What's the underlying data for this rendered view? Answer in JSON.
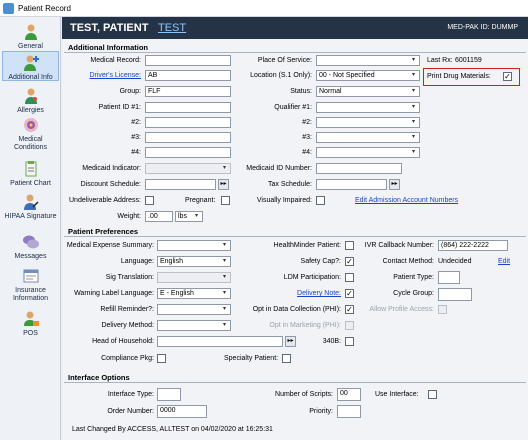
{
  "window": {
    "title": "Patient Record"
  },
  "sidebar": {
    "items": [
      {
        "label": "General",
        "icon": "person-icon"
      },
      {
        "label": "Additional Info",
        "icon": "person-plus-icon"
      },
      {
        "label": "Allergies",
        "icon": "allergy-icon"
      },
      {
        "label": "Medical Conditions",
        "icon": "condition-icon"
      },
      {
        "label": "Patient Chart",
        "icon": "chart-icon"
      },
      {
        "label": "HIPAA Signature",
        "icon": "signature-icon"
      },
      {
        "label": "Messages",
        "icon": "messages-icon"
      },
      {
        "label": "Insurance Information",
        "icon": "insurance-icon"
      },
      {
        "label": "POS",
        "icon": "pos-icon"
      }
    ]
  },
  "header": {
    "patient_name": "TEST, PATIENT",
    "patient_link": "TEST",
    "medpak": "MED-PAK ID: DUMMP"
  },
  "additional": {
    "heading": "Additional Information",
    "medical_record_label": "Medical Record:",
    "medical_record_value": "",
    "drivers_license_label": "Driver's License:",
    "drivers_license_value": "AB",
    "group_label": "Group:",
    "group_value": "FLF",
    "patient_id1_label": "Patient ID #1:",
    "id2_label": "#2:",
    "id3_label": "#3:",
    "id4_label": "#4:",
    "medicaid_indicator_label": "Medicaid Indicator:",
    "discount_schedule_label": "Discount Schedule:",
    "undeliverable_label": "Undeliverable Address:",
    "pregnant_label": "Pregnant:",
    "weight_label": "Weight:",
    "weight_value": ".00",
    "weight_unit": "lbs",
    "place_of_service_label": "Place Of Service:",
    "location_label": "Location (S.1 Only):",
    "location_value": "00 - Not Specified",
    "status_label": "Status:",
    "status_value": "Normal",
    "qualifier1_label": "Qualifier #1:",
    "q2_label": "#2:",
    "q3_label": "#3:",
    "q4_label": "#4:",
    "medicaid_id_label": "Medicaid ID Number:",
    "tax_schedule_label": "Tax Schedule:",
    "visually_impaired_label": "Visually Impaired:",
    "edit_admission_link": "Edit Admission Account Numbers",
    "last_rx_label": "Last Rx:",
    "last_rx_value": "6001159",
    "print_drug_label": "Print Drug Materials:",
    "print_drug_checked": "✓"
  },
  "preferences": {
    "heading": "Patient Preferences",
    "medical_expense_label": "Medical Expense Summary:",
    "language_label": "Language:",
    "language_value": "English",
    "sig_translation_label": "Sig Translation:",
    "warning_label_language_label": "Warning Label Language:",
    "warning_label_language_value": "E - English",
    "refill_reminder_label": "Refill Reminder?:",
    "delivery_method_label": "Delivery Method:",
    "head_of_household_label": "Head of Household:",
    "compliance_pkg_label": "Compliance Pkg:",
    "specialty_patient_label": "Specialty Patient:",
    "healthminder_label": "HealthMinder Patient:",
    "safety_cap_label": "Safety Cap?:",
    "safety_cap_checked": "✓",
    "ldm_label": "LDM Participation:",
    "delivery_note_link": "Delivery Note:",
    "delivery_note_checked": "✓",
    "opt_in_data_label": "Opt in Data Collection (PHI):",
    "opt_in_data_checked": "✓",
    "opt_in_marketing_label": "Opt in Marketing (PHI):",
    "b340_label": "340B:",
    "ivr_label": "IVR Callback Number:",
    "ivr_value": "(864) 222-2222",
    "contact_method_label": "Contact Method:",
    "contact_method_value": "Undecided",
    "edit_link": "Edit",
    "patient_type_label": "Patient Type:",
    "cycle_group_label": "Cycle Group:",
    "allow_profile_label": "Allow Profile Access:"
  },
  "interface": {
    "heading": "Interface Options",
    "interface_type_label": "Interface Type:",
    "order_number_label": "Order Number:",
    "order_number_value": "0000",
    "number_of_scripts_label": "Number of Scripts:",
    "number_of_scripts_value": "00",
    "priority_label": "Priority:",
    "use_interface_label": "Use Interface:"
  },
  "footer": {
    "last_changed": "Last Changed By  ACCESS, ALLTEST on 04/02/2020 at 16:25:31"
  },
  "icons": {
    "dropdown_arrow": "▾",
    "more_button": "▸▸"
  }
}
